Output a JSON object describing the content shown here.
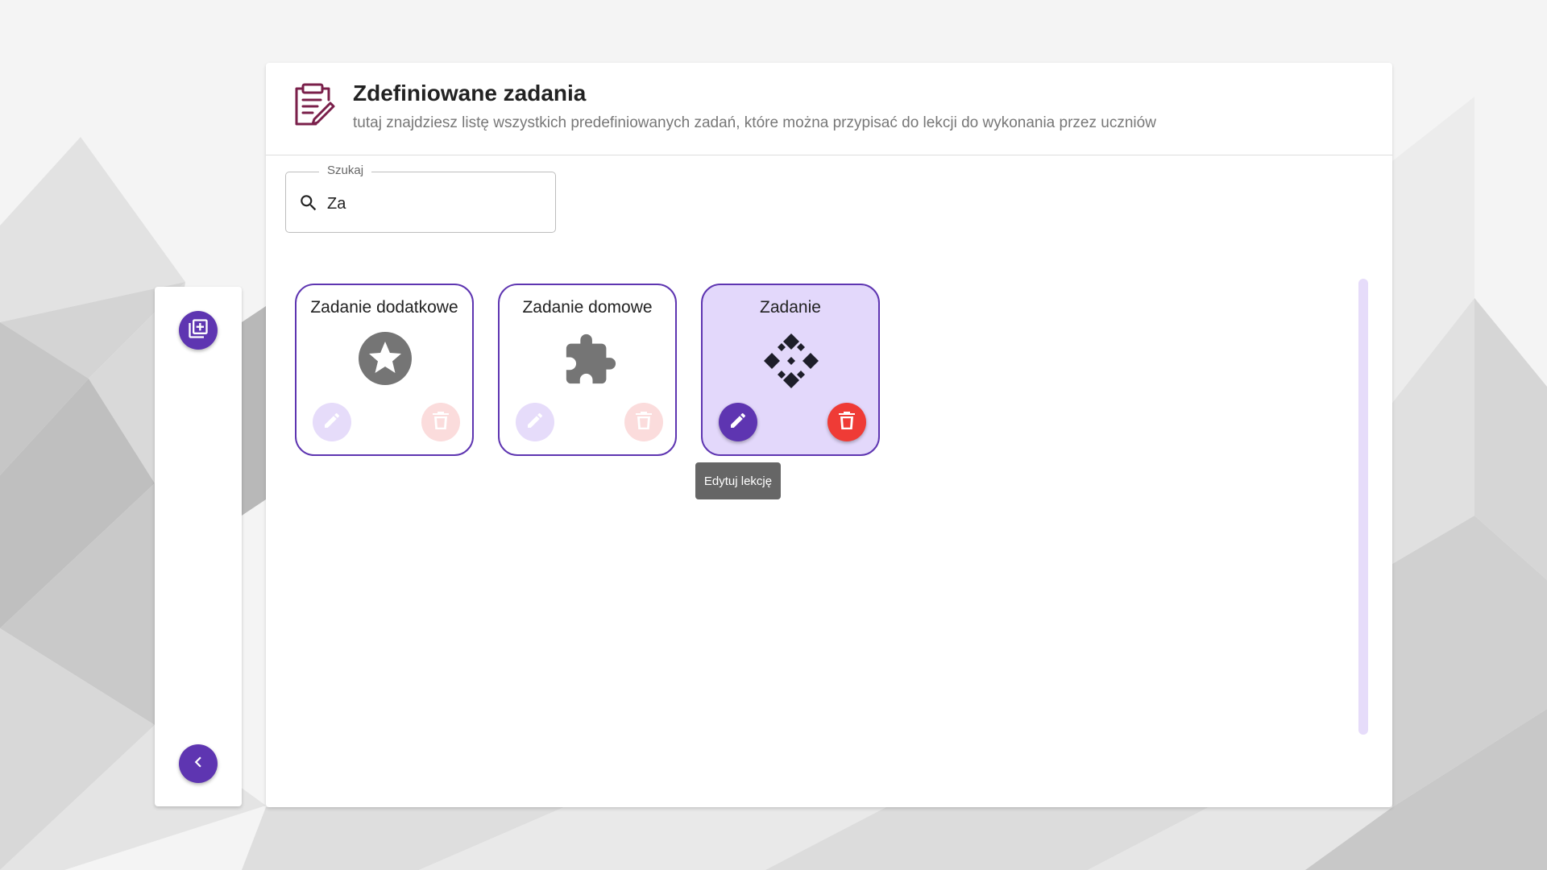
{
  "header": {
    "title": "Zdefiniowane zadania",
    "subtitle": "tutaj znajdziesz listę wszystkich predefiniowanych zadań, które można przypisać do lekcji do wykonania przez uczniów",
    "icon": "clipboard-edit-icon"
  },
  "search": {
    "label": "Szukaj",
    "value": "Za",
    "icon": "search-icon"
  },
  "sidebar": {
    "add_icon": "library-add-icon",
    "back_icon": "chevron-left-icon"
  },
  "cards": [
    {
      "title": "Zadanie dodatkowe",
      "icon": "star-circle-icon",
      "state": "dimmed"
    },
    {
      "title": "Zadanie domowe",
      "icon": "puzzle-icon",
      "state": "dimmed"
    },
    {
      "title": "Zadanie",
      "icon": "diamond-cluster-icon",
      "state": "active"
    }
  ],
  "tooltip": {
    "text": "Edytuj lekcję"
  },
  "colors": {
    "accent": "#5e35b1",
    "accent_light": "#e3d8fb",
    "danger": "#ef3b36",
    "title_icon": "#7a1f4a"
  }
}
